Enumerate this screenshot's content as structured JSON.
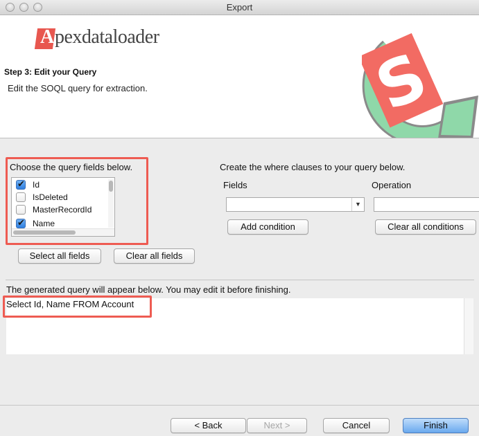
{
  "window": {
    "title": "Export"
  },
  "header": {
    "logo_first_letter": "A",
    "logo_rest": "pexdataloader",
    "step_title": "Step 3: Edit your Query",
    "step_description": "Edit the SOQL query for extraction.",
    "brand_colors": {
      "red": "#f26b63",
      "green": "#8fd8a9",
      "grey": "#8a8a8a"
    }
  },
  "field_chooser": {
    "label": "Choose the query fields below.",
    "fields": [
      {
        "name": "Id",
        "checked": true
      },
      {
        "name": "IsDeleted",
        "checked": false
      },
      {
        "name": "MasterRecordId",
        "checked": false
      },
      {
        "name": "Name",
        "checked": true
      }
    ],
    "select_all_label": "Select all fields",
    "clear_all_label": "Clear all fields"
  },
  "where_builder": {
    "label": "Create the where clauses to your query below.",
    "fields_label": "Fields",
    "operation_label": "Operation",
    "fields_value": "",
    "operation_value": "",
    "add_condition_label": "Add condition",
    "clear_conditions_label": "Clear all conditions"
  },
  "query": {
    "label": "The generated query will appear below.  You may edit it before finishing.",
    "text": "Select Id, Name FROM Account"
  },
  "footer": {
    "back_label": "< Back",
    "next_label": "Next >",
    "cancel_label": "Cancel",
    "finish_label": "Finish"
  },
  "colors": {
    "highlight": "#ee5b52",
    "checkbox_checked": "#2f7fe0",
    "primary_button": "#6aa9ee"
  }
}
